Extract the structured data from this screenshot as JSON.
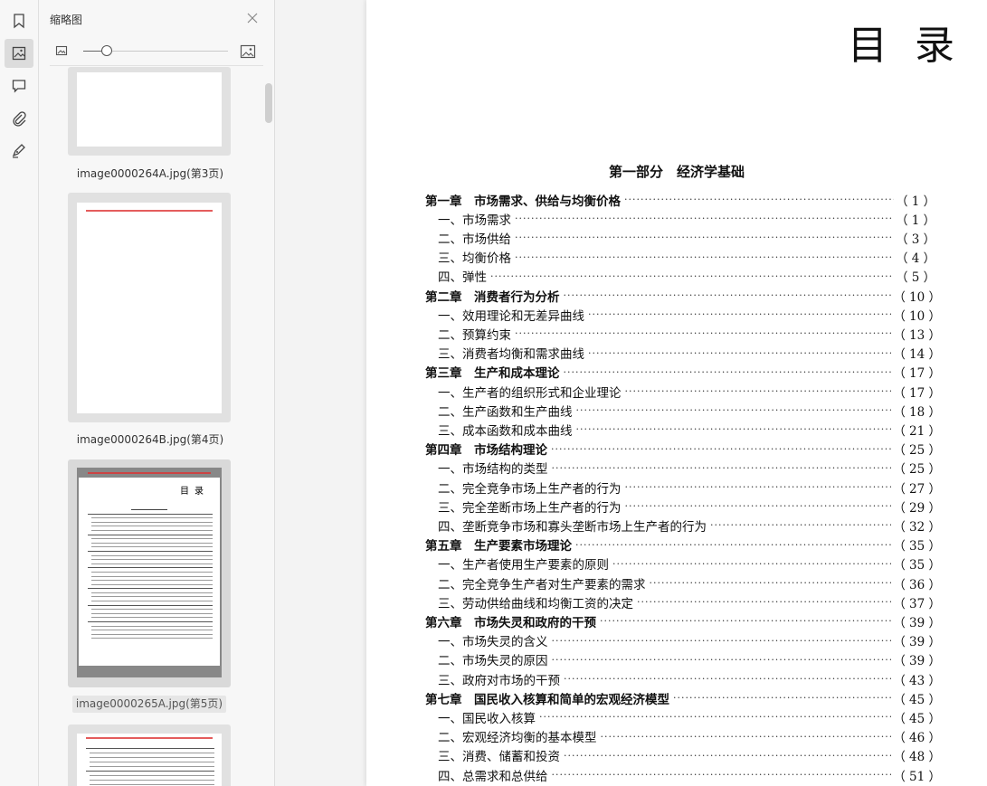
{
  "rail": {
    "items": [
      {
        "name": "bookmark-icon"
      },
      {
        "name": "thumbnail-icon",
        "active": true
      },
      {
        "name": "comment-icon"
      },
      {
        "name": "attachment-icon"
      },
      {
        "name": "signature-icon"
      }
    ]
  },
  "panel": {
    "title": "缩略图",
    "thumbnails": [
      {
        "label": "image0000264A.jpg(第3页)"
      },
      {
        "label": "image0000264B.jpg(第4页)"
      },
      {
        "label": "image0000265A.jpg(第5页)",
        "selected": true
      },
      {
        "label": ""
      }
    ]
  },
  "document": {
    "heading": "目录",
    "part_title": "第一部分　经济学基础",
    "entries": [
      {
        "type": "chapter",
        "text": "第一章　市场需求、供给与均衡价格",
        "page": "（  1  ）"
      },
      {
        "type": "section",
        "text": "一、市场需求",
        "page": "（  1  ）"
      },
      {
        "type": "section",
        "text": "二、市场供给",
        "page": "（  3  ）"
      },
      {
        "type": "section",
        "text": "三、均衡价格",
        "page": "（  4  ）"
      },
      {
        "type": "section",
        "text": "四、弹性",
        "page": "（  5  ）"
      },
      {
        "type": "chapter",
        "text": "第二章　消费者行为分析",
        "page": "（ 10 ）"
      },
      {
        "type": "section",
        "text": "一、效用理论和无差异曲线",
        "page": "（ 10 ）"
      },
      {
        "type": "section",
        "text": "二、预算约束",
        "page": "（ 13 ）"
      },
      {
        "type": "section",
        "text": "三、消费者均衡和需求曲线",
        "page": "（ 14 ）"
      },
      {
        "type": "chapter",
        "text": "第三章　生产和成本理论",
        "page": "（ 17 ）"
      },
      {
        "type": "section",
        "text": "一、生产者的组织形式和企业理论",
        "page": "（ 17 ）"
      },
      {
        "type": "section",
        "text": "二、生产函数和生产曲线",
        "page": "（ 18 ）"
      },
      {
        "type": "section",
        "text": "三、成本函数和成本曲线",
        "page": "（ 21 ）"
      },
      {
        "type": "chapter",
        "text": "第四章　市场结构理论",
        "page": "（ 25 ）"
      },
      {
        "type": "section",
        "text": "一、市场结构的类型",
        "page": "（ 25 ）"
      },
      {
        "type": "section",
        "text": "二、完全竞争市场上生产者的行为",
        "page": "（ 27 ）"
      },
      {
        "type": "section",
        "text": "三、完全垄断市场上生产者的行为",
        "page": "（ 29 ）"
      },
      {
        "type": "section",
        "text": "四、垄断竞争市场和寡头垄断市场上生产者的行为",
        "page": "（ 32 ）"
      },
      {
        "type": "chapter",
        "text": "第五章　生产要素市场理论",
        "page": "（ 35 ）"
      },
      {
        "type": "section",
        "text": "一、生产者使用生产要素的原则",
        "page": "（ 35 ）"
      },
      {
        "type": "section",
        "text": "二、完全竞争生产者对生产要素的需求",
        "page": "（ 36 ）"
      },
      {
        "type": "section",
        "text": "三、劳动供给曲线和均衡工资的决定",
        "page": "（ 37 ）"
      },
      {
        "type": "chapter",
        "text": "第六章　市场失灵和政府的干预",
        "page": "（ 39 ）"
      },
      {
        "type": "section",
        "text": "一、市场失灵的含义",
        "page": "（ 39 ）"
      },
      {
        "type": "section",
        "text": "二、市场失灵的原因",
        "page": "（ 39 ）"
      },
      {
        "type": "section",
        "text": "三、政府对市场的干预",
        "page": "（ 43 ）"
      },
      {
        "type": "chapter",
        "text": "第七章　国民收入核算和简单的宏观经济模型",
        "page": "（ 45 ）"
      },
      {
        "type": "section",
        "text": "一、国民收入核算",
        "page": "（ 45 ）"
      },
      {
        "type": "section",
        "text": "二、宏观经济均衡的基本模型",
        "page": "（ 46 ）"
      },
      {
        "type": "section",
        "text": "三、消费、储蓄和投资",
        "page": "（ 48 ）"
      },
      {
        "type": "section",
        "text": "四、总需求和总供给",
        "page": "（ 51 ）"
      }
    ]
  },
  "colors": {
    "panel_bg": "#f7f7f7",
    "thumb_frame": "#e1e1e1",
    "page_bg": "#ffffff",
    "header_red": "#dd3333"
  }
}
